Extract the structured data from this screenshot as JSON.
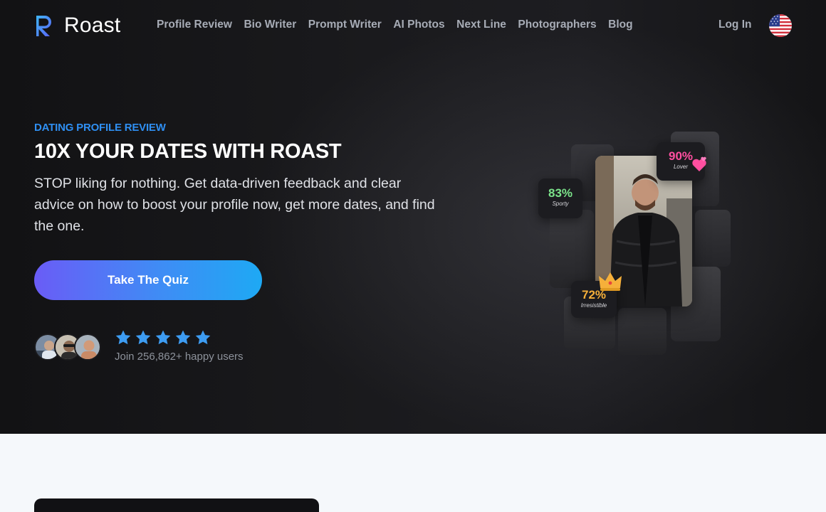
{
  "brand": {
    "name": "Roast"
  },
  "nav": {
    "items": [
      {
        "label": "Profile Review"
      },
      {
        "label": "Bio Writer"
      },
      {
        "label": "Prompt Writer"
      },
      {
        "label": "AI Photos"
      },
      {
        "label": "Next Line"
      },
      {
        "label": "Photographers"
      },
      {
        "label": "Blog"
      }
    ],
    "login_label": "Log In",
    "language_icon": "us-flag-icon"
  },
  "hero": {
    "eyebrow": "DATING PROFILE REVIEW",
    "headline": "10X YOUR DATES WITH ROAST",
    "subtext": "STOP liking for nothing. Get data-driven feedback and clear advice on how to boost your profile now, get more dates, and find the one.",
    "cta_label": "Take The Quiz",
    "rating_stars": 5,
    "social_proof": "Join 256,862+ happy users"
  },
  "collage": {
    "badges": [
      {
        "value": "90%",
        "label": "Lover",
        "icon": "hearts-icon"
      },
      {
        "value": "83%",
        "label": "Sporty"
      },
      {
        "value": "72%",
        "label": "Irresistible",
        "icon": "crown-icon"
      }
    ]
  },
  "colors": {
    "accent": "#2f8ff2",
    "cta_start": "#6a5cf6",
    "cta_end": "#1ea9f4",
    "star": "#3d9cf2",
    "lover": "#ff4fa0",
    "sporty": "#7be38a",
    "irresistible": "#f6b03a"
  }
}
